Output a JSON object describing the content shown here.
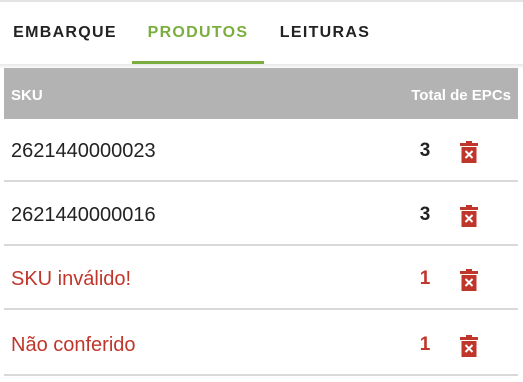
{
  "tabs": [
    {
      "label": "EMBARQUE",
      "active": false
    },
    {
      "label": "PRODUTOS",
      "active": true
    },
    {
      "label": "LEITURAS",
      "active": false
    }
  ],
  "table": {
    "header": {
      "sku": "SKU",
      "total": "Total de EPCs"
    },
    "rows": [
      {
        "sku": "2621440000023",
        "count": "3",
        "status": "ok",
        "action_icon": "trash-icon"
      },
      {
        "sku": "2621440000016",
        "count": "3",
        "status": "ok",
        "action_icon": "trash-icon"
      },
      {
        "sku": "SKU inválido!",
        "count": "1",
        "status": "error",
        "action_icon": "trash-icon"
      },
      {
        "sku": "Não conferido",
        "count": "1",
        "status": "error",
        "action_icon": "trash-icon"
      }
    ]
  },
  "colors": {
    "accent": "#7aae3e",
    "header_bg": "#b3b3b3",
    "error": "#c1362b",
    "text": "#222222"
  }
}
